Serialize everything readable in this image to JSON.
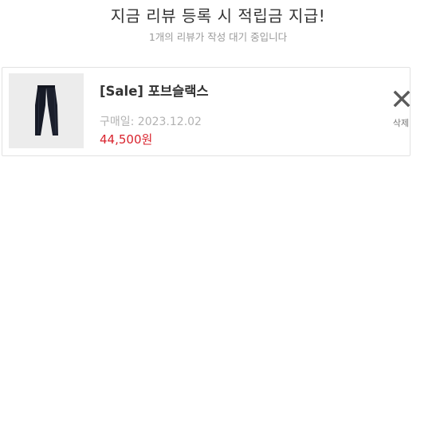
{
  "header": {
    "title": "지금 리뷰 등록 시 적립금 지급!",
    "subtitle": "1개의 리뷰가 작성 대기 중입니다"
  },
  "review_item": {
    "product_name": "[Sale] 포브슬랙스",
    "purchase_date_label": "구매일: 2023.12.02",
    "price": "44,500원",
    "delete_label": "삭제",
    "delete_icon": "close-icon",
    "thumbnail": "black-slacks-image"
  },
  "colors": {
    "price": "#d9232d",
    "title": "#333333",
    "muted": "#b2b2b2",
    "border": "#e2e2e2",
    "thumb_bg": "#ececec"
  }
}
